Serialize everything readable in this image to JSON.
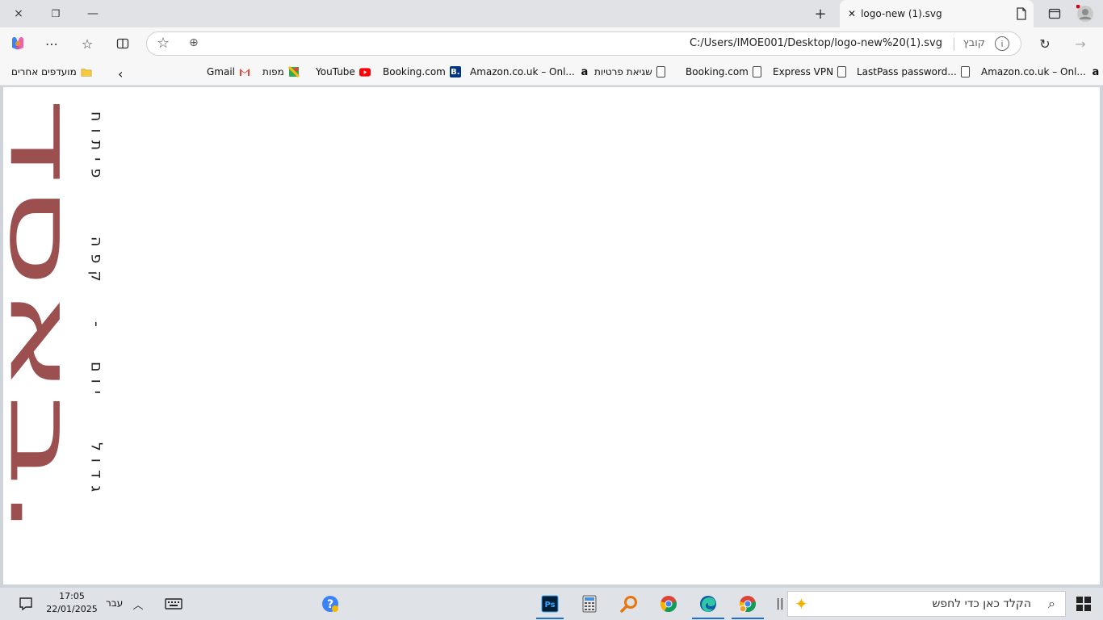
{
  "window": {
    "tab_title": "logo-new (1).svg",
    "close_icon": "×",
    "restore_icon": "❐",
    "minimize_icon": "—"
  },
  "toolbar": {
    "url": "C:/Users/IMOE001/Desktop/logo-new%20(1).svg",
    "file_label": "קובץ"
  },
  "bookmarks": {
    "other_favorites": "מועדפים אחרים",
    "items": [
      {
        "label": "Gmail",
        "icon": "gmail-icon"
      },
      {
        "label": "מפות",
        "icon": "maps-icon"
      },
      {
        "label": "YouTube",
        "icon": "youtube-icon"
      },
      {
        "label": "Booking.com",
        "icon": "booking-icon"
      },
      {
        "label": "Amazon.co.uk – Onl...",
        "icon": "amazon-icon"
      },
      {
        "label": "שגיאת פרטיות",
        "icon": "page-icon"
      },
      {
        "label": "Booking.com",
        "icon": "page-icon"
      },
      {
        "label": "Express VPN",
        "icon": "page-icon"
      },
      {
        "label": "LastPass password...",
        "icon": "page-icon"
      },
      {
        "label": "Amazon.co.uk – Onl...",
        "icon": "amazon-icon"
      }
    ]
  },
  "logo": {
    "brand_text": "באסד.",
    "tagline_lines": [
      "פיתוח",
      "קפה",
      "-",
      "יום",
      "גדול"
    ],
    "color": "#9b4f4f"
  },
  "taskbar": {
    "time": "17:05",
    "date": "22/01/2025",
    "language": "עבר",
    "search_placeholder": "הקלד כאן כדי לחפש"
  },
  "colors": {
    "accent": "#1f6fd1",
    "logo": "#9b4f4f"
  }
}
